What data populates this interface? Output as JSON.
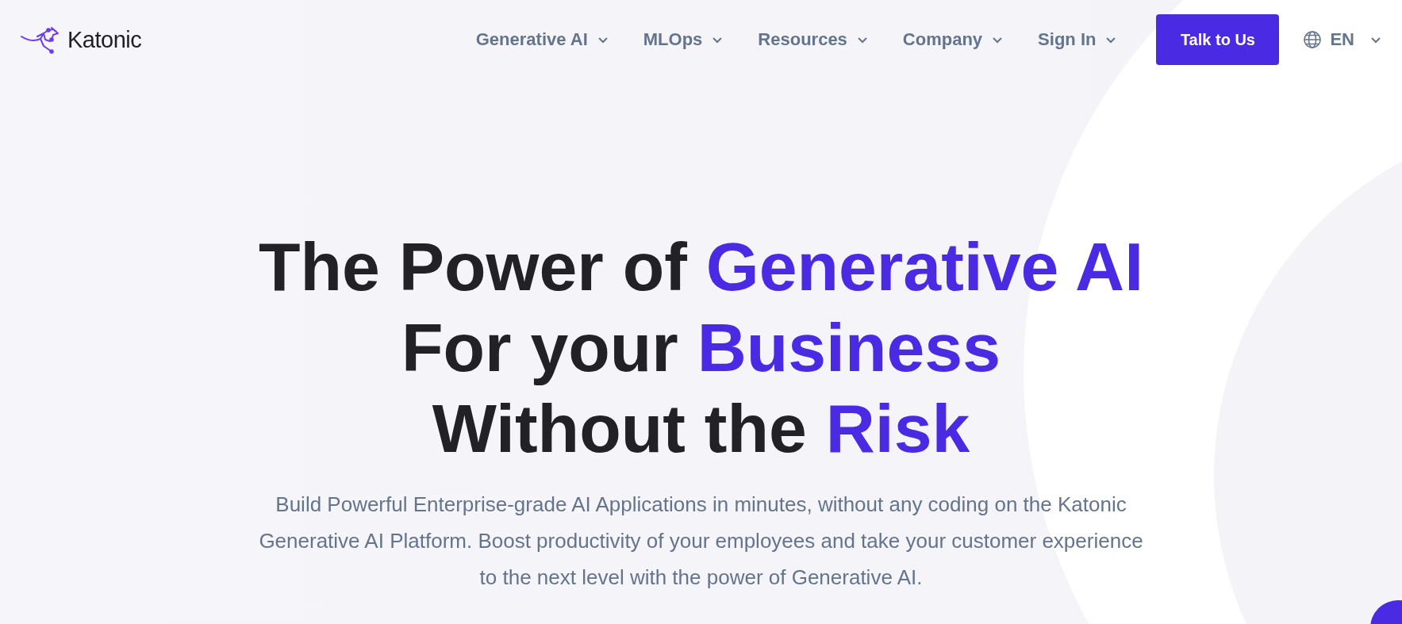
{
  "logo": {
    "text": "Katonic"
  },
  "nav": {
    "items": [
      {
        "label": "Generative AI"
      },
      {
        "label": "MLOps"
      },
      {
        "label": "Resources"
      },
      {
        "label": "Company"
      },
      {
        "label": "Sign In"
      }
    ],
    "cta": "Talk to Us",
    "language": "EN"
  },
  "hero": {
    "headline": [
      {
        "plain": "The Power of",
        "accent": "Generative AI"
      },
      {
        "plain": "For your",
        "accent": "Business"
      },
      {
        "plain": "Without the",
        "accent": "Risk"
      }
    ],
    "description": "Build Powerful Enterprise-grade AI Applications in minutes, without any coding on the Katonic Generative AI Platform. Boost productivity of your employees and take your customer experience to the next level with the power of Generative AI."
  }
}
